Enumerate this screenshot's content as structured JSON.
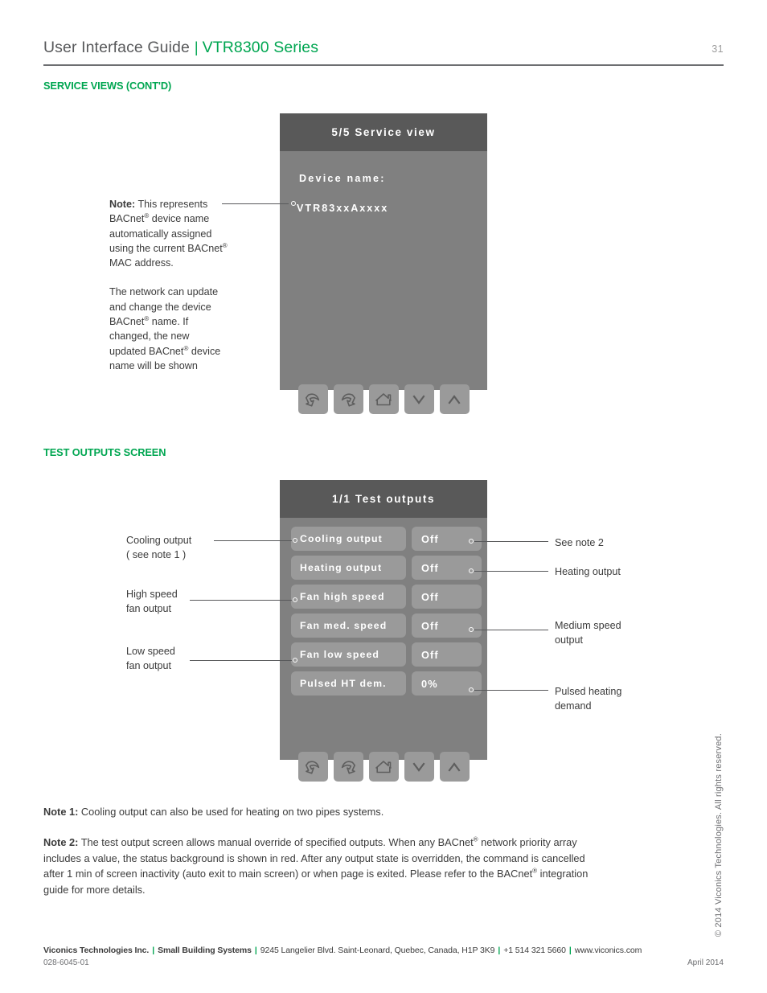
{
  "header": {
    "title": "User Interface Guide",
    "separator": "|",
    "series": "VTR8300 Series",
    "page_number": "31"
  },
  "sections": {
    "service_views": "SERVICE VIEWS (CONT'D)",
    "test_outputs": "TEST OUTPUTS SCREEN"
  },
  "service_screen": {
    "title": "5/5 Service view",
    "device_name_label": "Device name:",
    "device_name_value": "VTR83xxAxxxx",
    "nav_icons": [
      "undo-arrow-icon",
      "redo-arrow-icon",
      "home-icon",
      "chevron-down-icon",
      "chevron-up-icon"
    ]
  },
  "service_callout": {
    "para1_bold": "Note:",
    "para1_rest": " This represents BACnet® device name automatically assigned using the current BACnet® MAC address.",
    "para2": "The network can update and change the device BACnet® name. If changed, the new updated BACnet® device name will be shown"
  },
  "test_screen": {
    "title": "1/1 Test outputs",
    "rows": [
      {
        "name": "Cooling output",
        "state": "Off"
      },
      {
        "name": "Heating output",
        "state": "Off"
      },
      {
        "name": "Fan high speed",
        "state": "Off"
      },
      {
        "name": "Fan med. speed",
        "state": "Off"
      },
      {
        "name": "Fan low speed",
        "state": "Off"
      },
      {
        "name": "Pulsed HT dem.",
        "state": "0%"
      }
    ],
    "nav_icons": [
      "undo-arrow-icon",
      "redo-arrow-icon",
      "home-icon",
      "chevron-down-icon",
      "chevron-up-icon"
    ]
  },
  "test_callouts_left": [
    {
      "line1": "Cooling output",
      "line2": "( see note 1 )"
    },
    {
      "line1": "High speed",
      "line2": "fan output"
    },
    {
      "line1": "Low speed",
      "line2": "fan output"
    }
  ],
  "test_callouts_right": [
    {
      "line1": "See note 2",
      "line2": ""
    },
    {
      "line1": "Heating output",
      "line2": ""
    },
    {
      "line1": "Medium speed",
      "line2": "output"
    },
    {
      "line1": "Pulsed heating",
      "line2": "demand"
    }
  ],
  "notes": {
    "note1_label": "Note 1:",
    "note1_text": " Cooling output can also be used for heating on two pipes systems.",
    "note2_label": "Note 2:",
    "note2_text": " The test output screen allows manual override of specified outputs. When any BACnet® network priority array includes a value, the status background is shown in red. After any output state is overridden, the command is cancelled after 1 min of screen inactivity (auto exit to main screen) or when page is exited. Please refer to the BACnet® integration guide for more details."
  },
  "vertical_copyright": "© 2014 Viconics Technologies. All rights reserved.",
  "footer": {
    "company": "Viconics Technologies Inc.",
    "division": "Small Building Systems",
    "address": "9245 Langelier Blvd. Saint-Leonard, Quebec, Canada, H1P 3K9",
    "phone": "+1 514 321 5660",
    "website": "www.viconics.com",
    "doc_number": "028-6045-01",
    "date": "April 2014"
  },
  "colors": {
    "brand_green": "#00a651",
    "screen_header": "#595959",
    "screen_body": "#808080",
    "screen_pill": "#9a9a9a",
    "text_dark": "#3b3b3b"
  }
}
